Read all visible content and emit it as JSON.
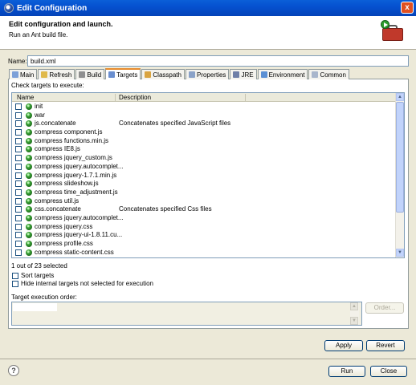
{
  "window": {
    "title": "Edit Configuration",
    "close_label": "x"
  },
  "header": {
    "title": "Edit configuration and launch.",
    "subtitle": "Run an Ant build file."
  },
  "name_field": {
    "label": "Name:",
    "value": "build.xml"
  },
  "tabs": [
    {
      "label": "Main",
      "icon": "main-tab-icon",
      "color": "#7da0d8"
    },
    {
      "label": "Refresh",
      "icon": "refresh-icon",
      "color": "#e0b94a"
    },
    {
      "label": "Build",
      "icon": "build-icon",
      "color": "#8f8f8f"
    },
    {
      "label": "Targets",
      "icon": "targets-icon",
      "color": "#6a8fd0"
    },
    {
      "label": "Classpath",
      "icon": "classpath-icon",
      "color": "#d9a441"
    },
    {
      "label": "Properties",
      "icon": "properties-icon",
      "color": "#8aa2c8"
    },
    {
      "label": "JRE",
      "icon": "jre-icon",
      "color": "#6f7fa8"
    },
    {
      "label": "Environment",
      "icon": "environment-icon",
      "color": "#5a8fd4"
    },
    {
      "label": "Common",
      "icon": "common-icon",
      "color": "#a9b6cc"
    }
  ],
  "targets": {
    "label": "Check targets to execute:",
    "columns": {
      "name": "Name",
      "description": "Description"
    },
    "rows": [
      {
        "name": "init",
        "description": ""
      },
      {
        "name": "war",
        "description": ""
      },
      {
        "name": "js.concatenate",
        "description": "Concatenates specified JavaScript files"
      },
      {
        "name": "compress component.js",
        "description": ""
      },
      {
        "name": "compress functions.min.js",
        "description": ""
      },
      {
        "name": "compress IE8.js",
        "description": ""
      },
      {
        "name": "compress jquery_custom.js",
        "description": ""
      },
      {
        "name": "compress jquery.autocomplet...",
        "description": ""
      },
      {
        "name": "compress jquery-1.7.1.min.js",
        "description": ""
      },
      {
        "name": "compress slideshow.js",
        "description": ""
      },
      {
        "name": "compress time_adjustment.js",
        "description": ""
      },
      {
        "name": "compress util.js",
        "description": ""
      },
      {
        "name": "css.concatenate",
        "description": "Concatenates specified Css files"
      },
      {
        "name": "compress jquery.autocomplet...",
        "description": ""
      },
      {
        "name": "compress jquery.css",
        "description": ""
      },
      {
        "name": "compress jquery-ui-1.8.11.cu...",
        "description": ""
      },
      {
        "name": "compress profile.css",
        "description": ""
      },
      {
        "name": "compress static-content.css",
        "description": ""
      }
    ],
    "selected_count": "1 out of 23 selected"
  },
  "options": {
    "sort_targets": "Sort targets",
    "hide_internal": "Hide internal targets not selected for execution"
  },
  "order": {
    "label": "Target execution order:",
    "order_button": "Order..."
  },
  "buttons": {
    "apply": "Apply",
    "revert": "Revert",
    "run": "Run",
    "close": "Close",
    "help": "?"
  }
}
